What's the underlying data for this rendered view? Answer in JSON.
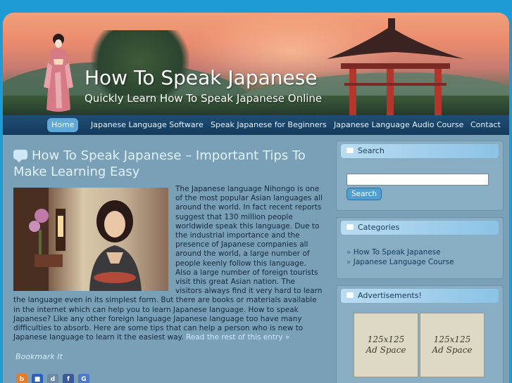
{
  "site": {
    "title": "How To Speak Japanese",
    "tagline": "Quickly Learn How To Speak Japanese Online"
  },
  "nav": {
    "items": [
      {
        "label": "Home",
        "active": true
      },
      {
        "label": "Japanese Language Software",
        "active": false
      },
      {
        "label": "Speak Japanese for Beginners",
        "active": false
      },
      {
        "label": "Japanese Language Audio Course",
        "active": false
      },
      {
        "label": "Contact",
        "active": false
      }
    ]
  },
  "post": {
    "title": "How To Speak Japanese – Important Tips To Make Learning Easy",
    "body": "The Japanese language Nihongo is one of the most popular Asian languages all around the world. In fact recent reports suggest that 130 million people worldwide speak this language. Due to the industrial importance and the presence of Japanese companies all around the world, a large number of people keenly follow this language. Also a large number of foreign tourists visit this great Asian nation. The visitors always find it very hard to learn the language even in its simplest form. But there are books or materials available in the internet which can help you to learn Japanese language. How to speak Japanese? Like any other foreign language Japanese language too have many difficulties to absorb. Here are some tips that can help a person who is new to Japanese language to learn it the easiest way.",
    "read_more": "Read the rest of this entry »",
    "bookmark": "Bookmark It"
  },
  "sidebar": {
    "search": {
      "title": "Search",
      "placeholder": "",
      "button": "Search"
    },
    "categories": {
      "title": "Categories",
      "items": [
        "How To Speak Japanese",
        "Japanese Language Course"
      ]
    },
    "ads": {
      "title": "Advertisements!",
      "slots": [
        {
          "line1": "125x125",
          "line2": "Ad Space"
        },
        {
          "line1": "125x125",
          "line2": "Ad Space"
        }
      ]
    }
  },
  "colors": {
    "page_bg": "#1e9bd4",
    "nav_bg": "#1f4e74",
    "nav_active": "#5fa8d8",
    "content_bg": "#7aa0b8",
    "title_text": "#dff2ff"
  },
  "bookmark_icons": [
    "blogger-icon",
    "delicious-icon",
    "digg-icon",
    "facebook-icon",
    "google-icon"
  ]
}
